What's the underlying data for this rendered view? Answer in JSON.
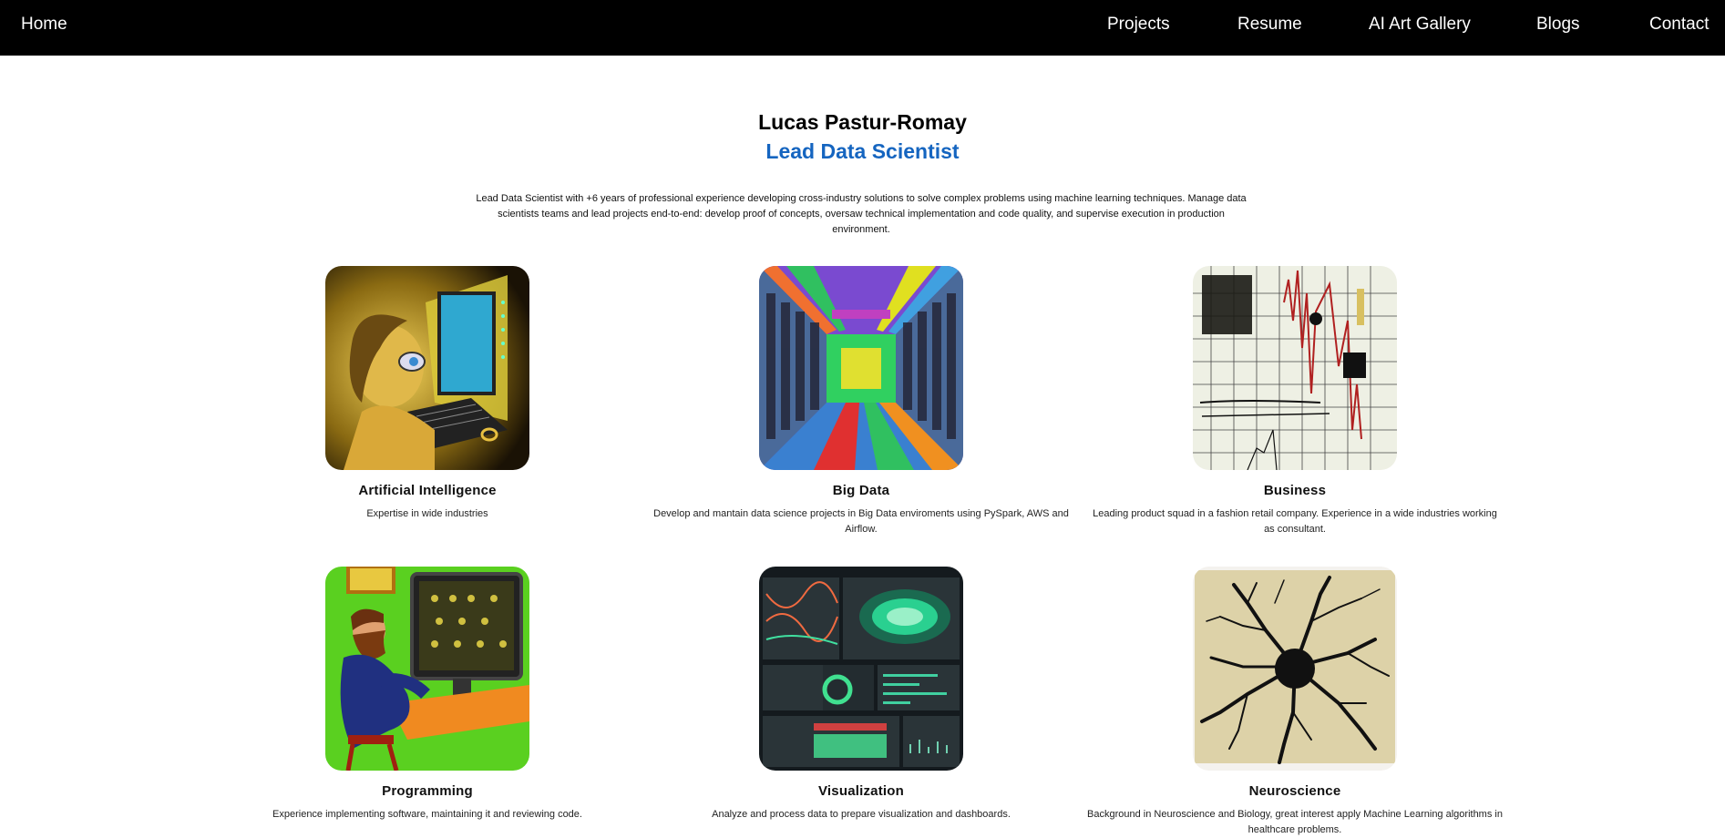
{
  "nav": {
    "home": "Home",
    "projects": "Projects",
    "resume": "Resume",
    "ai_art_gallery": "AI Art Gallery",
    "blogs": "Blogs",
    "contact": "Contact"
  },
  "hero": {
    "name": "Lucas Pastur-Romay",
    "role": "Lead Data Scientist",
    "intro": "Lead Data Scientist with +6 years of professional experience developing cross-industry solutions to solve complex problems using machine learning techniques. Manage data scientists teams and lead projects end-to-end: develop proof of concepts, oversaw technical implementation and code quality, and supervise execution in production environment."
  },
  "cards": [
    {
      "title": "Artificial Intelligence",
      "description": "Expertise in wide industries",
      "icon": "ai-portrait-image"
    },
    {
      "title": "Big Data",
      "description": "Develop and mantain data science projects in Big Data enviroments using PySpark, AWS and Airflow.",
      "icon": "server-corridor-image"
    },
    {
      "title": "Business",
      "description": "Leading product squad in a fashion retail company. Experience in a wide industries working as consultant.",
      "icon": "grid-chart-sketch-image"
    },
    {
      "title": "Programming",
      "description": "Experience implementing software, maintaining it and reviewing code.",
      "icon": "programmer-painting-image"
    },
    {
      "title": "Visualization",
      "description": "Analyze and process data to prepare visualization and dashboards.",
      "icon": "dashboard-image"
    },
    {
      "title": "Neuroscience",
      "description": "Background in Neuroscience and Biology, great interest apply Machine Learning algorithms in healthcare problems.",
      "icon": "neuron-drawing-image"
    }
  ],
  "colors": {
    "nav_bg": "#000000",
    "accent": "#1565c0"
  }
}
